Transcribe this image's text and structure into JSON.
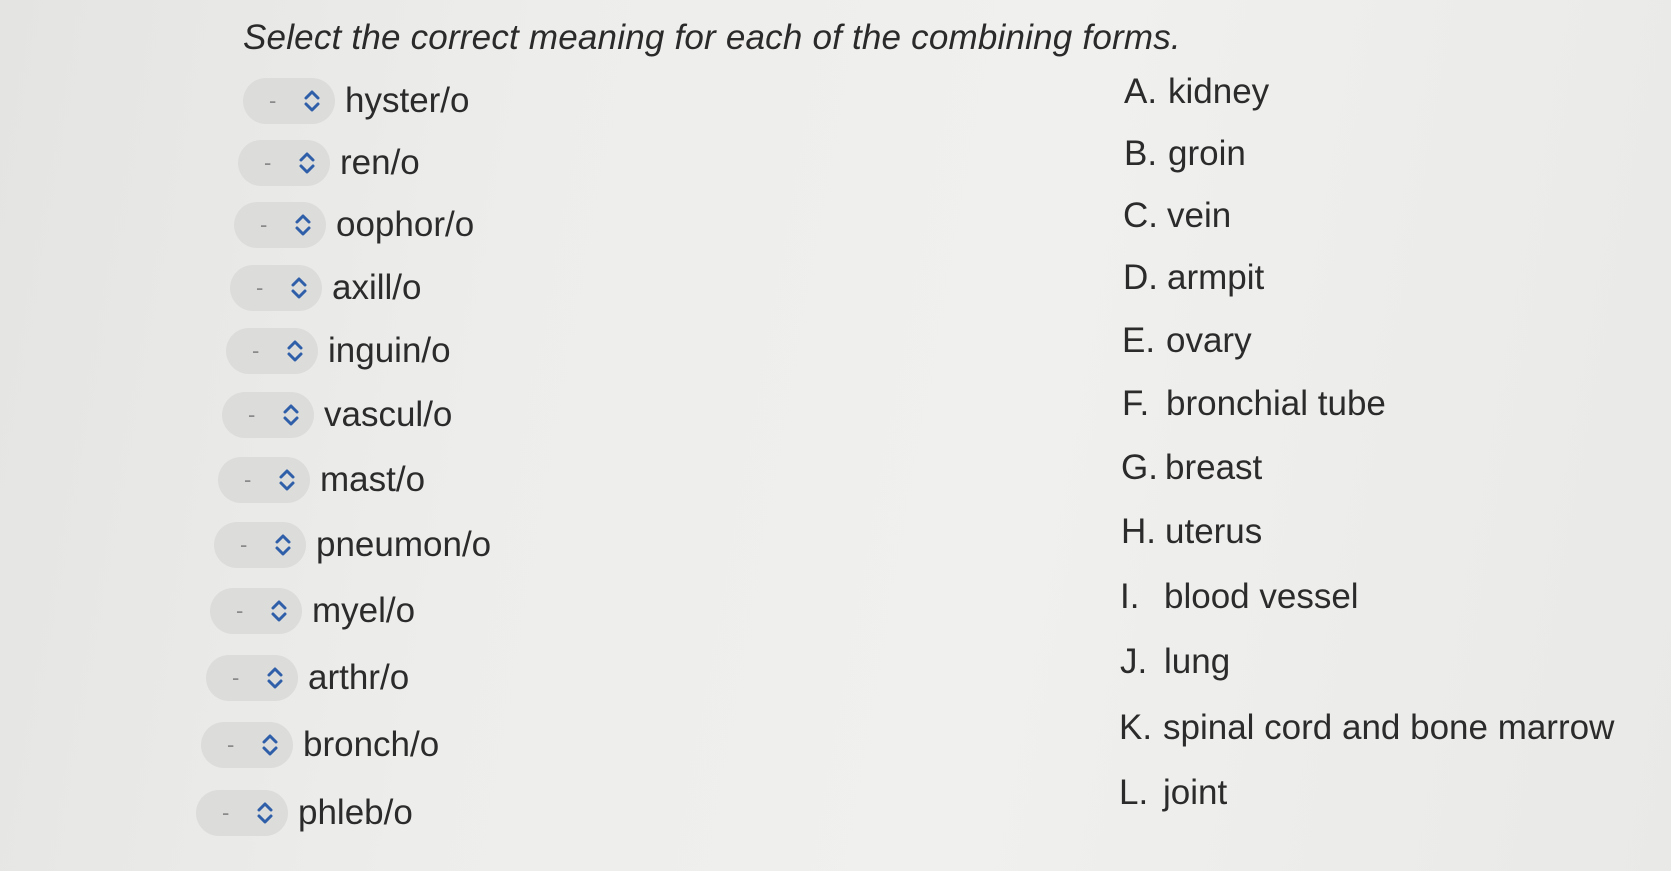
{
  "instruction": "Select the correct meaning for each of the combining forms.",
  "dropdowns": [
    {
      "selected": "-",
      "term": "hyster/o"
    },
    {
      "selected": "-",
      "term": "ren/o"
    },
    {
      "selected": "-",
      "term": "oophor/o"
    },
    {
      "selected": "-",
      "term": "axill/o"
    },
    {
      "selected": "-",
      "term": "inguin/o"
    },
    {
      "selected": "-",
      "term": "vascul/o"
    },
    {
      "selected": "-",
      "term": "mast/o"
    },
    {
      "selected": "-",
      "term": "pneumon/o"
    },
    {
      "selected": "-",
      "term": "myel/o"
    },
    {
      "selected": "-",
      "term": "arthr/o"
    },
    {
      "selected": "-",
      "term": "bronch/o"
    },
    {
      "selected": "-",
      "term": "phleb/o"
    }
  ],
  "answers": [
    {
      "letter": "A.",
      "text": "kidney"
    },
    {
      "letter": "B.",
      "text": "groin"
    },
    {
      "letter": "C.",
      "text": "vein"
    },
    {
      "letter": "D.",
      "text": "armpit"
    },
    {
      "letter": "E.",
      "text": "ovary"
    },
    {
      "letter": "F.",
      "text": "bronchial tube"
    },
    {
      "letter": "G.",
      "text": "breast"
    },
    {
      "letter": "H.",
      "text": "uterus"
    },
    {
      "letter": "I.",
      "text": "blood vessel"
    },
    {
      "letter": "J.",
      "text": "lung"
    },
    {
      "letter": "K.",
      "text": "spinal cord and bone marrow"
    },
    {
      "letter": "L.",
      "text": "joint"
    }
  ],
  "icons": {
    "dropdown_chevron": "chevron-up-down-icon"
  },
  "colors": {
    "chevron": "#2f5fa8",
    "pill": "#dcdcda",
    "text": "#2b2b2b"
  }
}
